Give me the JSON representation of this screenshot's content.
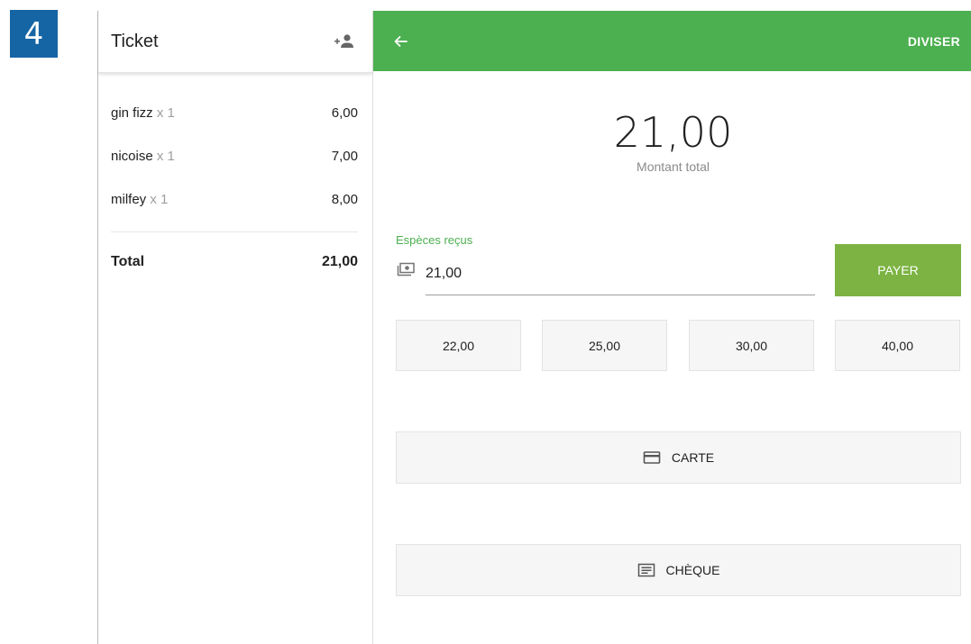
{
  "step_badge": "4",
  "ticket": {
    "title": "Ticket",
    "add_customer_icon": "person-add-icon",
    "items": [
      {
        "name": "gin fizz",
        "qty": "x 1",
        "price": "6,00"
      },
      {
        "name": "nicoise",
        "qty": "x 1",
        "price": "7,00"
      },
      {
        "name": "milfey",
        "qty": "x 1",
        "price": "8,00"
      }
    ],
    "total_label": "Total",
    "total_value": "21,00"
  },
  "payment": {
    "back_icon": "arrow-left-icon",
    "split_label": "DIVISER",
    "amount": "21,00",
    "amount_label": "Montant total",
    "cash_label": "Espèces reçus",
    "cash_value": "21,00",
    "pay_label": "PAYER",
    "quick_amounts": [
      "22,00",
      "25,00",
      "30,00",
      "40,00"
    ],
    "card_label": "CARTE",
    "cheque_label": "CHÈQUE"
  },
  "colors": {
    "topbar": "#4caf50",
    "pay_button": "#7cb342",
    "badge": "#1565a5",
    "accent_label": "#4caf50"
  }
}
